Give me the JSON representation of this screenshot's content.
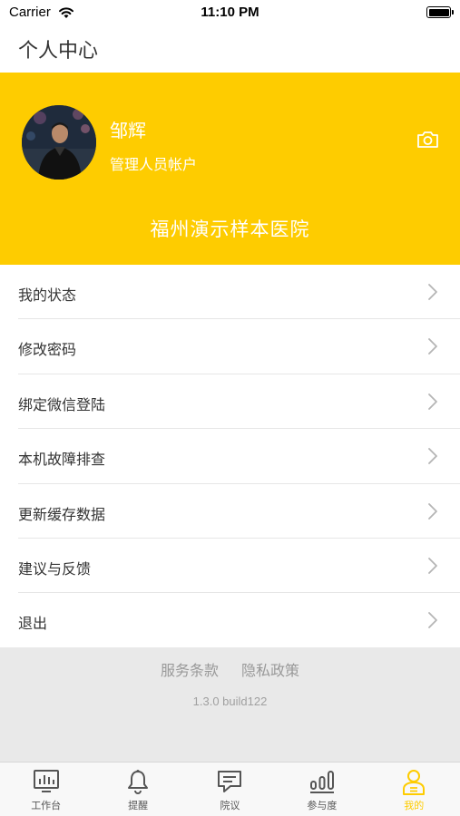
{
  "status_bar": {
    "carrier": "Carrier",
    "time": "11:10 PM"
  },
  "header": {
    "title": "个人中心"
  },
  "profile": {
    "name": "邹辉",
    "account_type": "管理人员帐户",
    "hospital": "福州演示样本医院",
    "camera_icon": "camera-icon",
    "bg_color": "#FECC00"
  },
  "menu": {
    "items": [
      {
        "label": "我的状态",
        "icon": "chevron-right-icon"
      },
      {
        "label": "修改密码",
        "icon": "chevron-right-icon"
      },
      {
        "label": "绑定微信登陆",
        "icon": "chevron-right-icon"
      },
      {
        "label": "本机故障排查",
        "icon": "chevron-right-icon"
      },
      {
        "label": "更新缓存数据",
        "icon": "chevron-right-icon"
      },
      {
        "label": "建议与反馈",
        "icon": "chevron-right-icon"
      },
      {
        "label": "退出",
        "icon": "chevron-right-icon"
      }
    ]
  },
  "footer": {
    "terms": "服务条款",
    "privacy": "隐私政策",
    "version": "1.3.0 build122"
  },
  "tabbar": {
    "active_color": "#FECC00",
    "tabs": [
      {
        "label": "工作台",
        "icon": "dashboard-icon"
      },
      {
        "label": "提醒",
        "icon": "bell-icon"
      },
      {
        "label": "院议",
        "icon": "chat-icon"
      },
      {
        "label": "参与度",
        "icon": "bar-chart-icon"
      },
      {
        "label": "我的",
        "icon": "user-icon",
        "active": true
      }
    ]
  }
}
